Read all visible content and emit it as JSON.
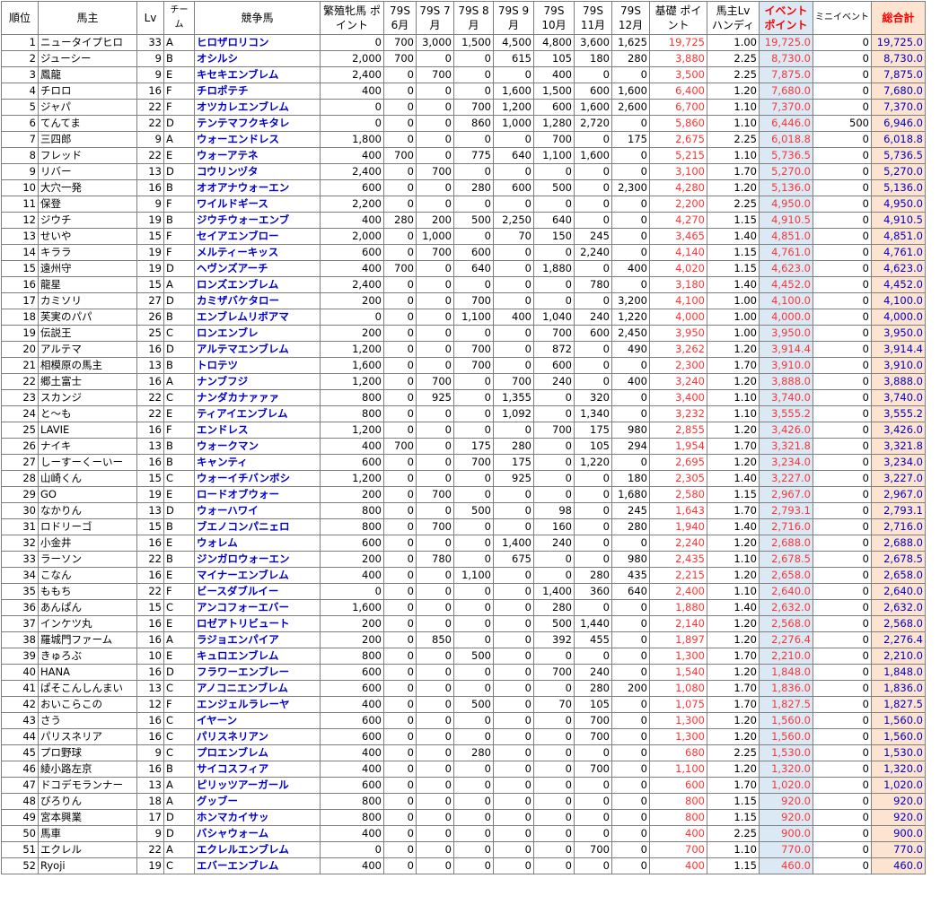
{
  "header": {
    "rank": "順位",
    "owner": "馬主",
    "lv": "Lv",
    "team": "チーム",
    "horse": "競争馬",
    "breed": "繁殖牝馬 ポイント",
    "m6": "79S 6月",
    "m7": "79S 7月",
    "m8": "79S 8月",
    "m9": "79S 9月",
    "m10": "79S 10月",
    "m11": "79S 11月",
    "m12": "79S 12月",
    "base": "基礎 ポイント",
    "handi": "馬主Lv ハンディ",
    "event": "イベント ポイント",
    "mini": "ミニイベント",
    "total": "総合計"
  },
  "rows": [
    [
      "1",
      "ニュータイプヒロ",
      "33",
      "A",
      "ヒロザロリコン",
      "0",
      "700",
      "3,000",
      "1,500",
      "4,500",
      "4,800",
      "3,600",
      "1,625",
      "19,725",
      "1.00",
      "19,725.0",
      "0",
      "19,725.0"
    ],
    [
      "2",
      "ジューシー",
      "9",
      "B",
      "オシルシ",
      "2,000",
      "700",
      "0",
      "0",
      "615",
      "105",
      "180",
      "280",
      "3,880",
      "2.25",
      "8,730.0",
      "0",
      "8,730.0"
    ],
    [
      "3",
      "鳳龍",
      "9",
      "E",
      "キセキエンブレム",
      "2,400",
      "0",
      "700",
      "0",
      "0",
      "400",
      "0",
      "0",
      "3,500",
      "2.25",
      "7,875.0",
      "0",
      "7,875.0"
    ],
    [
      "4",
      "チロロ",
      "16",
      "F",
      "チロポテチ",
      "400",
      "0",
      "0",
      "0",
      "1,600",
      "1,500",
      "600",
      "1,600",
      "6,400",
      "1.20",
      "7,680.0",
      "0",
      "7,680.0"
    ],
    [
      "5",
      "ジャパ",
      "22",
      "F",
      "オツカレエンブレム",
      "0",
      "0",
      "0",
      "700",
      "1,200",
      "600",
      "1,600",
      "2,600",
      "6,700",
      "1.10",
      "7,370.0",
      "0",
      "7,370.0"
    ],
    [
      "6",
      "てんてま",
      "22",
      "D",
      "テンテマフクキタレ",
      "0",
      "0",
      "0",
      "860",
      "1,000",
      "1,280",
      "2,720",
      "0",
      "5,860",
      "1.10",
      "6,446.0",
      "500",
      "6,946.0"
    ],
    [
      "7",
      "三四郎",
      "9",
      "A",
      "ウォーエンドレス",
      "1,800",
      "0",
      "0",
      "0",
      "0",
      "700",
      "0",
      "175",
      "2,675",
      "2.25",
      "6,018.8",
      "0",
      "6,018.8"
    ],
    [
      "8",
      "フレッド",
      "22",
      "E",
      "ウォーアテネ",
      "400",
      "700",
      "0",
      "775",
      "640",
      "1,100",
      "1,600",
      "0",
      "5,215",
      "1.10",
      "5,736.5",
      "0",
      "5,736.5"
    ],
    [
      "9",
      "リバー",
      "13",
      "D",
      "コウリンヅタ",
      "2,400",
      "0",
      "700",
      "0",
      "0",
      "0",
      "0",
      "0",
      "3,100",
      "1.70",
      "5,270.0",
      "0",
      "5,270.0"
    ],
    [
      "10",
      "大穴一発",
      "16",
      "B",
      "オオアナウォーエン",
      "600",
      "0",
      "0",
      "280",
      "600",
      "500",
      "0",
      "2,300",
      "4,280",
      "1.20",
      "5,136.0",
      "0",
      "5,136.0"
    ],
    [
      "11",
      "保登",
      "9",
      "F",
      "ワイルドギース",
      "2,200",
      "0",
      "0",
      "0",
      "0",
      "0",
      "0",
      "0",
      "2,200",
      "2.25",
      "4,950.0",
      "0",
      "4,950.0"
    ],
    [
      "12",
      "ジウチ",
      "19",
      "B",
      "ジウチウォーエンブ",
      "400",
      "280",
      "200",
      "500",
      "2,250",
      "640",
      "0",
      "0",
      "4,270",
      "1.15",
      "4,910.5",
      "0",
      "4,910.5"
    ],
    [
      "13",
      "せいや",
      "15",
      "F",
      "セイアエンブロー",
      "2,000",
      "0",
      "1,000",
      "0",
      "70",
      "150",
      "245",
      "0",
      "3,465",
      "1.40",
      "4,851.0",
      "0",
      "4,851.0"
    ],
    [
      "14",
      "キララ",
      "19",
      "F",
      "メルティーキッス",
      "600",
      "0",
      "700",
      "600",
      "0",
      "0",
      "2,240",
      "0",
      "4,140",
      "1.15",
      "4,761.0",
      "0",
      "4,761.0"
    ],
    [
      "15",
      "遠州守",
      "19",
      "D",
      "ヘヴンズアーチ",
      "400",
      "700",
      "0",
      "640",
      "0",
      "1,880",
      "0",
      "400",
      "4,020",
      "1.15",
      "4,623.0",
      "0",
      "4,623.0"
    ],
    [
      "16",
      "龍星",
      "15",
      "A",
      "ロンズエンブレム",
      "2,400",
      "0",
      "0",
      "0",
      "0",
      "0",
      "780",
      "0",
      "3,180",
      "1.40",
      "4,452.0",
      "0",
      "4,452.0"
    ],
    [
      "17",
      "カミソリ",
      "27",
      "D",
      "カミザバケタロー",
      "200",
      "0",
      "0",
      "700",
      "0",
      "0",
      "0",
      "3,200",
      "4,100",
      "1.00",
      "4,100.0",
      "0",
      "4,100.0"
    ],
    [
      "18",
      "芙実のパパ",
      "26",
      "B",
      "エンブレムリボアマ",
      "0",
      "0",
      "0",
      "1,100",
      "400",
      "1,040",
      "240",
      "1,220",
      "4,000",
      "1.00",
      "4,000.0",
      "0",
      "4,000.0"
    ],
    [
      "19",
      "伝説王",
      "25",
      "C",
      "ロンエンブレ",
      "200",
      "0",
      "0",
      "0",
      "0",
      "700",
      "600",
      "2,450",
      "3,950",
      "1.00",
      "3,950.0",
      "0",
      "3,950.0"
    ],
    [
      "20",
      "アルテマ",
      "16",
      "D",
      "アルテマエンブレム",
      "1,200",
      "0",
      "0",
      "700",
      "0",
      "872",
      "0",
      "490",
      "3,262",
      "1.20",
      "3,914.4",
      "0",
      "3,914.4"
    ],
    [
      "21",
      "相模原の馬主",
      "13",
      "B",
      "トロテツ",
      "1,600",
      "0",
      "0",
      "700",
      "0",
      "600",
      "0",
      "0",
      "2,300",
      "1.70",
      "3,910.0",
      "0",
      "3,910.0"
    ],
    [
      "22",
      "郷土富士",
      "16",
      "A",
      "ナンブフジ",
      "1,200",
      "0",
      "700",
      "0",
      "700",
      "240",
      "0",
      "400",
      "3,240",
      "1.20",
      "3,888.0",
      "0",
      "3,888.0"
    ],
    [
      "23",
      "スカンジ",
      "22",
      "C",
      "ナンダカナァァァ",
      "800",
      "0",
      "925",
      "0",
      "1,355",
      "0",
      "320",
      "0",
      "3,400",
      "1.10",
      "3,740.0",
      "0",
      "3,740.0"
    ],
    [
      "24",
      "と～も",
      "22",
      "E",
      "ティアイエンブレム",
      "800",
      "0",
      "0",
      "0",
      "1,092",
      "0",
      "1,340",
      "0",
      "3,232",
      "1.10",
      "3,555.2",
      "0",
      "3,555.2"
    ],
    [
      "25",
      "LAVIE",
      "16",
      "F",
      "エンドレス",
      "1,200",
      "0",
      "0",
      "0",
      "0",
      "700",
      "175",
      "980",
      "2,855",
      "1.20",
      "3,426.0",
      "0",
      "3,426.0"
    ],
    [
      "26",
      "ナイキ",
      "13",
      "B",
      "ウォークマン",
      "400",
      "700",
      "0",
      "175",
      "280",
      "0",
      "105",
      "294",
      "1,954",
      "1.70",
      "3,321.8",
      "0",
      "3,321.8"
    ],
    [
      "27",
      "しーすーくーいー",
      "16",
      "B",
      "キャンティ",
      "600",
      "0",
      "0",
      "700",
      "175",
      "0",
      "1,220",
      "0",
      "2,695",
      "1.20",
      "3,234.0",
      "0",
      "3,234.0"
    ],
    [
      "28",
      "山崎くん",
      "15",
      "C",
      "ウォーイチバンボシ",
      "1,200",
      "0",
      "0",
      "0",
      "925",
      "0",
      "0",
      "180",
      "2,305",
      "1.40",
      "3,227.0",
      "0",
      "3,227.0"
    ],
    [
      "29",
      "GO",
      "19",
      "E",
      "ロードオブウォー",
      "200",
      "0",
      "700",
      "0",
      "0",
      "0",
      "0",
      "1,680",
      "2,580",
      "1.15",
      "2,967.0",
      "0",
      "2,967.0"
    ],
    [
      "30",
      "なかりん",
      "13",
      "D",
      "ウォーハワイ",
      "800",
      "0",
      "0",
      "500",
      "0",
      "98",
      "0",
      "245",
      "1,643",
      "1.70",
      "2,793.1",
      "0",
      "2,793.1"
    ],
    [
      "31",
      "ロドリーゴ",
      "15",
      "B",
      "ブエノコンパニェロ",
      "800",
      "0",
      "700",
      "0",
      "0",
      "160",
      "0",
      "280",
      "1,940",
      "1.40",
      "2,716.0",
      "0",
      "2,716.0"
    ],
    [
      "32",
      "小金井",
      "16",
      "E",
      "ウォレム",
      "600",
      "0",
      "0",
      "0",
      "1,400",
      "240",
      "0",
      "0",
      "2,240",
      "1.20",
      "2,688.0",
      "0",
      "2,688.0"
    ],
    [
      "33",
      "ラーソン",
      "22",
      "B",
      "ジンガロウォーエン",
      "200",
      "0",
      "780",
      "0",
      "675",
      "0",
      "0",
      "980",
      "2,435",
      "1.10",
      "2,678.5",
      "0",
      "2,678.5"
    ],
    [
      "34",
      "こなん",
      "16",
      "E",
      "マイナーエンブレム",
      "400",
      "0",
      "0",
      "1,100",
      "0",
      "0",
      "280",
      "435",
      "2,215",
      "1.20",
      "2,658.0",
      "0",
      "2,658.0"
    ],
    [
      "35",
      "ももち",
      "22",
      "F",
      "ビースダブルイー",
      "0",
      "0",
      "0",
      "0",
      "0",
      "1,400",
      "360",
      "640",
      "2,400",
      "1.10",
      "2,640.0",
      "0",
      "2,640.0"
    ],
    [
      "36",
      "あんぱん",
      "15",
      "C",
      "アンコフォーエバー",
      "1,600",
      "0",
      "0",
      "0",
      "0",
      "280",
      "0",
      "0",
      "1,880",
      "1.40",
      "2,632.0",
      "0",
      "2,632.0"
    ],
    [
      "37",
      "インケツ丸",
      "16",
      "E",
      "ロゼアトリビュート",
      "200",
      "0",
      "0",
      "0",
      "0",
      "500",
      "1,440",
      "0",
      "2,140",
      "1.20",
      "2,568.0",
      "0",
      "2,568.0"
    ],
    [
      "38",
      "羅城門ファーム",
      "16",
      "A",
      "ラジョエンパイア",
      "200",
      "0",
      "850",
      "0",
      "0",
      "392",
      "455",
      "0",
      "1,897",
      "1.20",
      "2,276.4",
      "0",
      "2,276.4"
    ],
    [
      "39",
      "きゅろぶ",
      "10",
      "E",
      "キュロエンブレム",
      "800",
      "0",
      "0",
      "500",
      "0",
      "0",
      "0",
      "0",
      "1,300",
      "1.70",
      "2,210.0",
      "0",
      "2,210.0"
    ],
    [
      "40",
      "HANA",
      "16",
      "D",
      "フラワーエンブレー",
      "600",
      "0",
      "0",
      "0",
      "0",
      "700",
      "240",
      "0",
      "1,540",
      "1.20",
      "1,848.0",
      "0",
      "1,848.0"
    ],
    [
      "41",
      "ぱそこんしんまい",
      "13",
      "C",
      "アノコニエンブレム",
      "600",
      "0",
      "0",
      "0",
      "0",
      "0",
      "280",
      "200",
      "1,080",
      "1.70",
      "1,836.0",
      "0",
      "1,836.0"
    ],
    [
      "42",
      "おいこらこの",
      "12",
      "F",
      "エンジェルラレーヤ",
      "400",
      "0",
      "0",
      "500",
      "0",
      "70",
      "105",
      "0",
      "1,075",
      "1.70",
      "1,827.5",
      "0",
      "1,827.5"
    ],
    [
      "43",
      "さう",
      "16",
      "C",
      "イヤーン",
      "600",
      "0",
      "0",
      "0",
      "0",
      "0",
      "700",
      "0",
      "1,300",
      "1.20",
      "1,560.0",
      "0",
      "1,560.0"
    ],
    [
      "44",
      "パリスネリア",
      "16",
      "C",
      "パリスネリアン",
      "600",
      "0",
      "0",
      "0",
      "0",
      "0",
      "700",
      "0",
      "1,300",
      "1.20",
      "1,560.0",
      "0",
      "1,560.0"
    ],
    [
      "45",
      "プロ野球",
      "9",
      "C",
      "プロエンブレム",
      "400",
      "0",
      "0",
      "280",
      "0",
      "0",
      "0",
      "0",
      "680",
      "2.25",
      "1,530.0",
      "0",
      "1,530.0"
    ],
    [
      "46",
      "綾小路左京",
      "16",
      "B",
      "サイコスフィア",
      "400",
      "0",
      "0",
      "0",
      "0",
      "0",
      "700",
      "0",
      "1,100",
      "1.20",
      "1,320.0",
      "0",
      "1,320.0"
    ],
    [
      "47",
      "ドコデモランナー",
      "13",
      "A",
      "ピリッツアーガール",
      "600",
      "0",
      "0",
      "0",
      "0",
      "0",
      "0",
      "0",
      "600",
      "1.70",
      "1,020.0",
      "0",
      "1,020.0"
    ],
    [
      "48",
      "ぴろりん",
      "18",
      "A",
      "グッブー",
      "800",
      "0",
      "0",
      "0",
      "0",
      "0",
      "0",
      "0",
      "800",
      "1.15",
      "920.0",
      "0",
      "920.0"
    ],
    [
      "49",
      "宮本興業",
      "17",
      "D",
      "ホンマカイサッ",
      "800",
      "0",
      "0",
      "0",
      "0",
      "0",
      "0",
      "0",
      "800",
      "1.15",
      "920.0",
      "0",
      "920.0"
    ],
    [
      "50",
      "馬車",
      "9",
      "D",
      "バシャウォーム",
      "400",
      "0",
      "0",
      "0",
      "0",
      "0",
      "0",
      "0",
      "400",
      "2.25",
      "900.0",
      "0",
      "900.0"
    ],
    [
      "51",
      "エクレル",
      "22",
      "A",
      "エクレルエンブレム",
      "0",
      "0",
      "0",
      "0",
      "0",
      "0",
      "700",
      "0",
      "700",
      "1.10",
      "770.0",
      "0",
      "770.0"
    ],
    [
      "52",
      "Ryoji",
      "19",
      "C",
      "エバーエンブレム",
      "400",
      "0",
      "0",
      "0",
      "0",
      "0",
      "0",
      "0",
      "400",
      "1.15",
      "460.0",
      "0",
      "460.0"
    ]
  ]
}
